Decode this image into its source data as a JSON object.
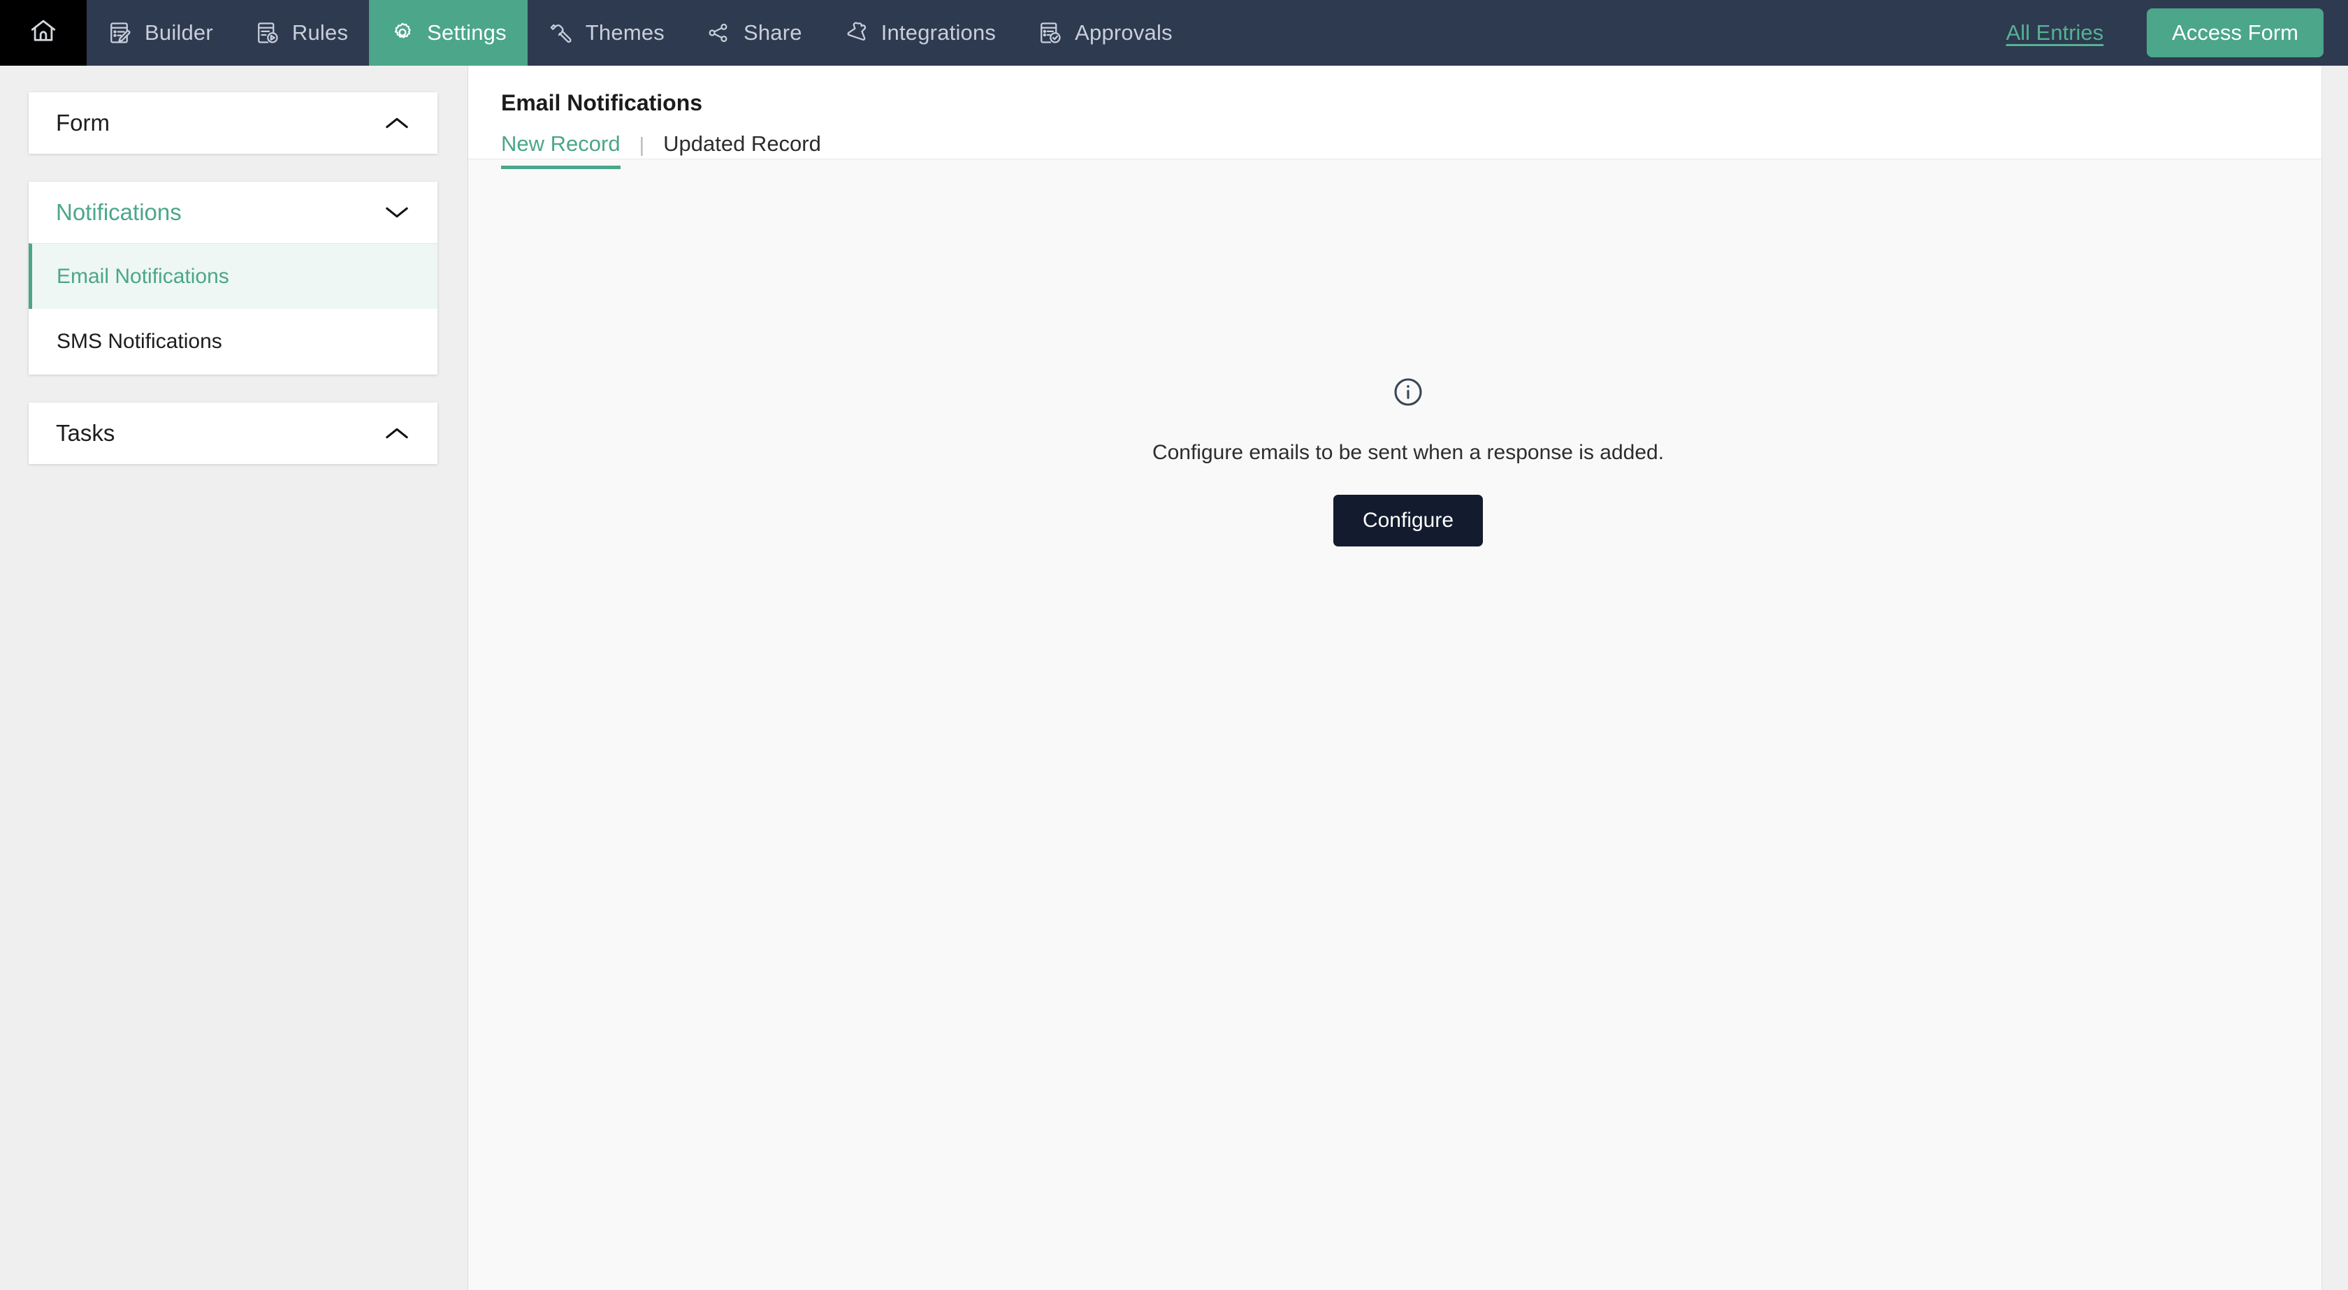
{
  "topnav": {
    "home_icon": "home-icon",
    "items": [
      {
        "label": "Builder",
        "icon": "document-pencil-icon",
        "active": false
      },
      {
        "label": "Rules",
        "icon": "document-play-icon",
        "active": false
      },
      {
        "label": "Settings",
        "icon": "gear-icon",
        "active": true
      },
      {
        "label": "Themes",
        "icon": "paint-roller-icon",
        "active": false
      },
      {
        "label": "Share",
        "icon": "share-nodes-icon",
        "active": false
      },
      {
        "label": "Integrations",
        "icon": "puzzle-piece-icon",
        "active": false
      },
      {
        "label": "Approvals",
        "icon": "document-check-icon",
        "active": false
      }
    ],
    "all_entries_label": "All Entries",
    "access_form_label": "Access Form",
    "accent_green": "#4ba68a",
    "bar_navy": "#2e3a50",
    "home_cell_black": "#000000"
  },
  "sidebar": {
    "panels": [
      {
        "title": "Form",
        "chevron": "chevron-up-icon",
        "expanded": true,
        "highlighted": false,
        "items": []
      },
      {
        "title": "Notifications",
        "chevron": "chevron-down-icon",
        "expanded": true,
        "highlighted": true,
        "items": [
          {
            "label": "Email Notifications",
            "selected": true
          },
          {
            "label": "SMS Notifications",
            "selected": false
          }
        ]
      },
      {
        "title": "Tasks",
        "chevron": "chevron-up-icon",
        "expanded": true,
        "highlighted": false,
        "items": []
      }
    ],
    "selected_bg": "#eef7f3",
    "selected_accent": "#4ba68a"
  },
  "main": {
    "page_title": "Email Notifications",
    "tabs": [
      {
        "label": "New Record",
        "active": true
      },
      {
        "label": "Updated Record",
        "active": false
      }
    ],
    "tab_separator": "|",
    "empty_state": {
      "icon": "info-circle-icon",
      "message": "Configure emails to be sent when a response is added.",
      "button_label": "Configure",
      "button_color": "#131c2e"
    }
  }
}
